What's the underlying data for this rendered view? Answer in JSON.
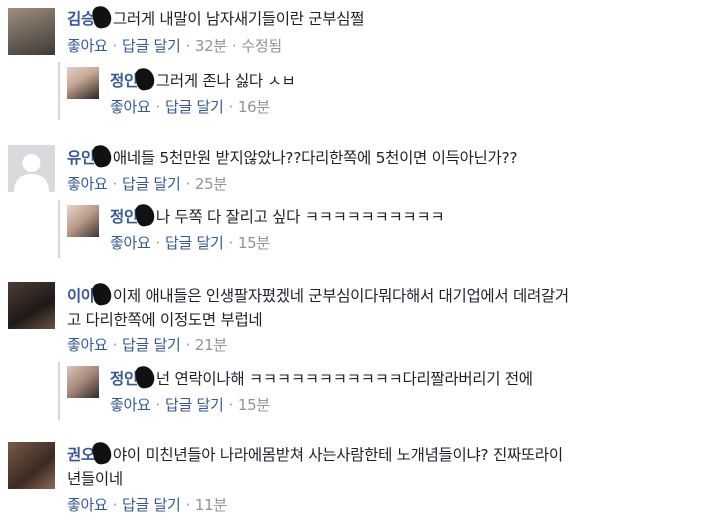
{
  "comments": [
    {
      "name": "김승",
      "text": "그러게 내말이 남자새기들이란 군부심쩔",
      "like": "좋아요",
      "reply": "답글 달기",
      "time": "32분",
      "edited": "수정됨",
      "replies": [
        {
          "name": "정인",
          "text": "그러게 존나 싫다 ㅅㅂ",
          "like": "좋아요",
          "reply": "답글 달기",
          "time": "16분"
        }
      ]
    },
    {
      "name": "유인",
      "text": "애네들 5천만원 받지않았나??다리한쪽에 5천이면 이득아닌가??",
      "like": "좋아요",
      "reply": "답글 달기",
      "time": "25분",
      "replies": [
        {
          "name": "정인",
          "text": "나 두쪽 다 잘리고 싶다 ㅋㅋㅋㅋㅋㅋㅋㅋㅋㅋ",
          "like": "좋아요",
          "reply": "답글 달기",
          "time": "15분"
        }
      ]
    },
    {
      "name": "이아",
      "text": "이제 애내들은 인생팔자폈겠네 군부심이다뭐다해서 대기업에서 데려갈거",
      "text2": "고 다리한쪽에 이정도면 부럽네",
      "like": "좋아요",
      "reply": "답글 달기",
      "time": "21분",
      "replies": [
        {
          "name": "정인",
          "text": "넌 연락이나해 ㅋㅋㅋㅋㅋㅋㅋㅋㅋㅋㅋ다리짤라버리기 전에",
          "like": "좋아요",
          "reply": "답글 달기",
          "time": "15분"
        }
      ]
    },
    {
      "name": "권오",
      "text": "야이 미친년들아 나라에몸받쳐 사는사람한테 노개념들이냐? 진짜또라이",
      "text2": "년들이네",
      "like": "좋아요",
      "reply": "답글 달기",
      "time": "11분"
    }
  ],
  "separator": "·"
}
